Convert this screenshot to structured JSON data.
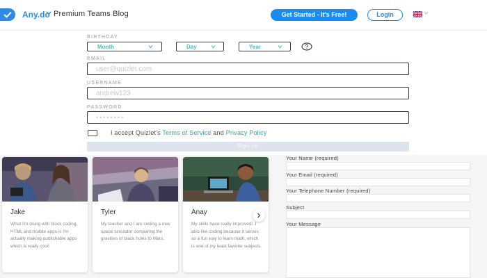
{
  "header": {
    "brand": "Any.do",
    "blog_title": "Premium Teams Blog",
    "cta_label": "Get Started - It's Free!",
    "login_label": "Login",
    "language_icon": "uk-flag-icon"
  },
  "signup": {
    "birthday_label": "BIRTHDAY",
    "month_value": "Month",
    "day_value": "Day",
    "year_value": "Year",
    "email_label": "EMAIL",
    "email_placeholder": "user@quizlet.com",
    "username_label": "USERNAME",
    "username_placeholder": "andrew123",
    "password_label": "PASSWORD",
    "password_placeholder": "••••••••",
    "terms_prefix": "I accept Quizlet's ",
    "terms_link": "Terms of Service",
    "terms_and": " and ",
    "privacy_link": "Privacy Policy",
    "signup_label": "Sign up"
  },
  "testimonials": [
    {
      "name": "Jake",
      "quote": "What I'm doing with block coding, HTML and mobile apps is I'm actually making publishable apps which is really cool!"
    },
    {
      "name": "Tyler",
      "quote": "My teacher and I are coding a new space simulator comparing the gravities of black holes to Mars."
    },
    {
      "name": "Anay",
      "quote": "My skills have really improved!..I also like coding because it serves as a fun way to learn math, which is one of my least favorite subjects."
    }
  ],
  "contact": {
    "name_label": "Your Name (required)",
    "email_label": "Your Email (required)",
    "phone_label": "Your Telephone Number (required)",
    "subject_label": "Subject",
    "message_label": "Your Message"
  },
  "colors": {
    "brand_blue": "#2b8be6",
    "cta_blue": "#1a8cf0",
    "teal_accent": "#4dbfb5",
    "link_teal": "#2aa8a0"
  }
}
